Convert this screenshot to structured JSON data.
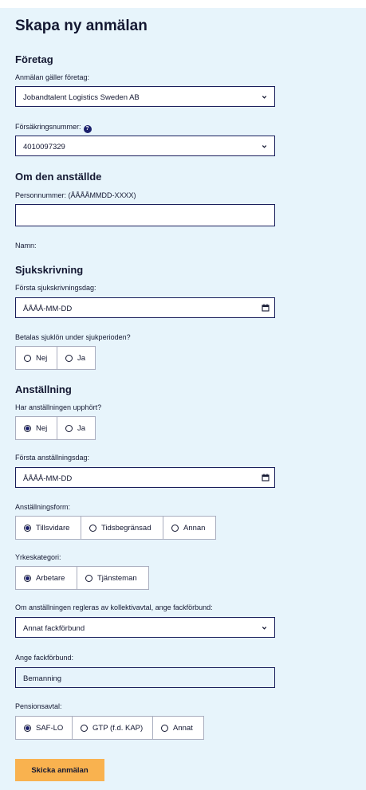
{
  "form": {
    "title": "Skapa ny anmälan",
    "submit_label": "Skicka anmälan"
  },
  "company": {
    "heading": "Företag",
    "company_label": "Anmälan gäller företag:",
    "company_value": "Jobandtalent Logistics Sweden AB",
    "insurance_label": "Försäkringsnummer:",
    "help_glyph": "?",
    "insurance_value": "4010097329"
  },
  "employee": {
    "heading": "Om den anställde",
    "pn_label": "Personnummer: (ÅÅÅÅMMDD-XXXX)",
    "pn_value": "",
    "name_label": "Namn:"
  },
  "sick": {
    "heading": "Sjukskrivning",
    "first_day_label": "Första sjukskrivningsdag:",
    "first_day_value": "ÅÅÅÅ-MM-DD",
    "sickpay_label": "Betalas sjuklön under sjukperioden?",
    "sickpay_options": [
      "Nej",
      "Ja"
    ],
    "sickpay_selected": null
  },
  "employment": {
    "heading": "Anställning",
    "ended_label": "Har anställningen upphört?",
    "ended_options": [
      "Nej",
      "Ja"
    ],
    "ended_selected": "Nej",
    "first_day_label": "Första anställningsdag:",
    "first_day_value": "ÅÅÅÅ-MM-DD",
    "form_label": "Anställningsform:",
    "form_options": [
      "Tillsvidare",
      "Tidsbegränsad",
      "Annan"
    ],
    "form_selected": "Tillsvidare",
    "category_label": "Yrkeskategori:",
    "category_options": [
      "Arbetare",
      "Tjänsteman"
    ],
    "category_selected": "Arbetare",
    "union_select_label": "Om anställningen regleras av kollektivavtal, ange fackförbund:",
    "union_select_value": "Annat fackförbund",
    "union_label": "Ange fackförbund:",
    "union_value": "Bemanning",
    "pension_label": "Pensionsavtal:",
    "pension_options": [
      "SAF-LO",
      "GTP (f.d. KAP)",
      "Annat"
    ],
    "pension_selected": "SAF-LO"
  },
  "icons": {
    "chevron": "chevron-down-icon",
    "calendar": "calendar-icon",
    "help": "help-icon"
  },
  "colors": {
    "panel_bg": "#e7f4fb",
    "navy": "#1a1f6b",
    "text": "#141832",
    "submit_bg": "#f9b24f",
    "option_border": "#a9aebf"
  }
}
